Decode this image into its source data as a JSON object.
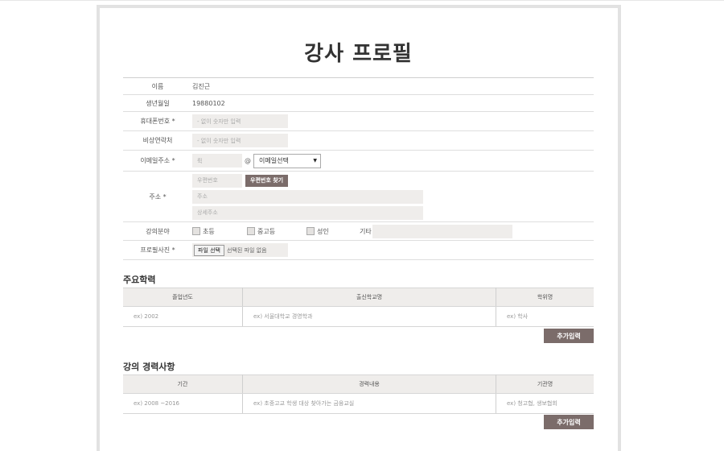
{
  "page": {
    "title": "강사 프로필"
  },
  "form": {
    "name": {
      "label": "이름",
      "value": "김진근"
    },
    "birth": {
      "label": "생년월일",
      "value": "19880102"
    },
    "mobile": {
      "label": "휴대폰번호 *",
      "placeholder": "- 없이 숫자만 입력"
    },
    "emergency": {
      "label": "비상연락처",
      "placeholder": "- 없이 숫자만 입력"
    },
    "email": {
      "label": "이메일주소 *",
      "local_placeholder": "뤽",
      "at": "@",
      "domain_select": "이메일선택"
    },
    "address": {
      "label": "주소 *",
      "zip_placeholder": "우편번호",
      "zip_button": "우편번호 찾기",
      "addr1_placeholder": "주소",
      "addr2_placeholder": "상세주소"
    },
    "field": {
      "label": "강의분야",
      "options": [
        "초등",
        "중고등",
        "성인"
      ],
      "etc_label": "기타"
    },
    "photo": {
      "label": "프로필사진 *",
      "button": "파일 선택",
      "status": "선택된 파일 없음"
    }
  },
  "education": {
    "title": "주요학력",
    "columns": [
      "졸업년도",
      "출신학교명",
      "학위명"
    ],
    "row": [
      "ex) 2002",
      "ex) 서울대학교 경영학과",
      "ex) 학사"
    ],
    "add_button": "추가입력"
  },
  "career": {
    "title": "강의 경력사항",
    "columns": [
      "기간",
      "경력내용",
      "기관명"
    ],
    "row": [
      "ex) 2008 ~2016",
      "ex) 초중고교 학생 대상 찾아가는 금융교실",
      "ex) 청고협, 생보협회"
    ],
    "add_button": "추가입력"
  }
}
